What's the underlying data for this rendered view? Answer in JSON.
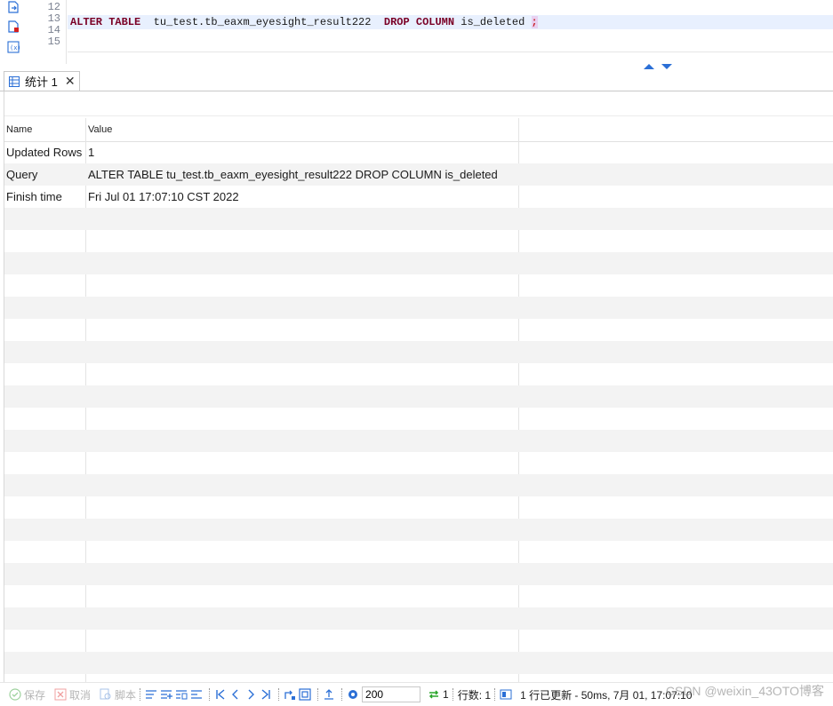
{
  "editor": {
    "line_numbers": [
      "12",
      "13",
      "14",
      "15"
    ],
    "code": {
      "kw1": "ALTER TABLE",
      "table": "  tu_test.tb_eaxm_eyesight_result222  ",
      "kw2": "DROP COLUMN",
      "column": " is_deleted ",
      "semi": ";"
    }
  },
  "tab": {
    "label": "统计 1",
    "close": "✕"
  },
  "grid": {
    "headers": [
      "Name",
      "Value"
    ],
    "rows": [
      {
        "name": "Updated Rows",
        "value": "1"
      },
      {
        "name": "Query",
        "value": "ALTER TABLE  tu_test.tb_eaxm_eyesight_result222  DROP COLUMN is_deleted"
      },
      {
        "name": "Finish time",
        "value": "Fri Jul 01 17:07:10 CST 2022"
      }
    ]
  },
  "statusbar": {
    "save": "保存",
    "cancel": "取消",
    "script": "脚本",
    "page_size": "200",
    "refresh_count": "1",
    "row_count": "行数: 1",
    "status_msg": "1 行已更新 - 50ms, 7月 01, 17:07:10",
    "watermark": "CSDN @weixin_43OTO博客"
  },
  "colors": {
    "accent": "#2b6fd6",
    "keyword": "#7a0026",
    "highlight_line": "#e8f0fe",
    "ok_green": "#2aa52a"
  }
}
